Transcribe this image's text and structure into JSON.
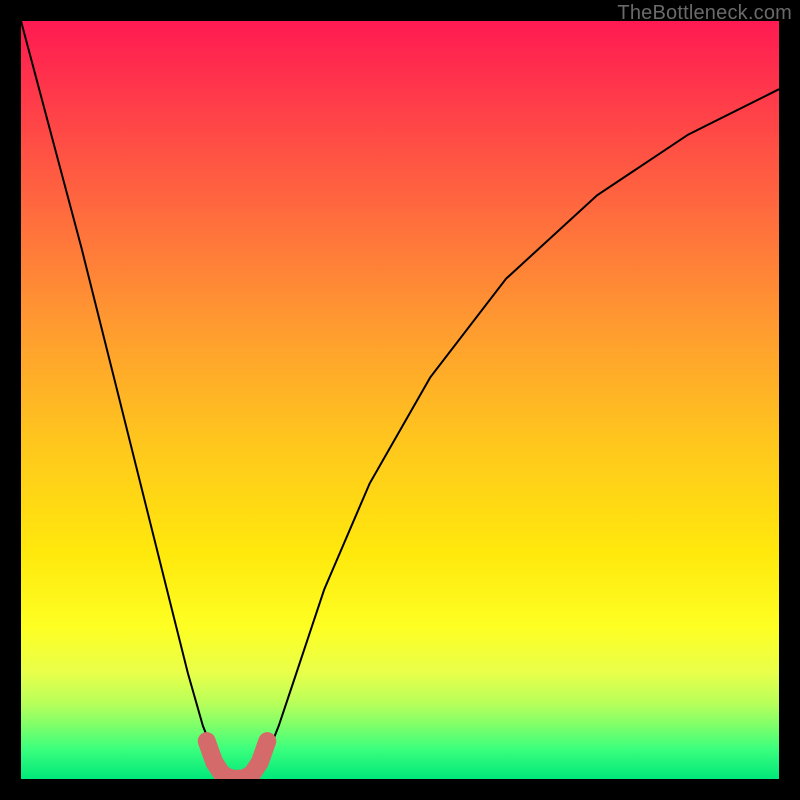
{
  "watermark": "TheBottleneck.com",
  "chart_data": {
    "type": "line",
    "title": "",
    "xlabel": "",
    "ylabel": "",
    "xlim": [
      0,
      100
    ],
    "ylim": [
      0,
      100
    ],
    "series": [
      {
        "name": "bottleneck-curve",
        "x": [
          0,
          4,
          8,
          12,
          16,
          20,
          22,
          24,
          26,
          27,
          28,
          29,
          30,
          31,
          32,
          34,
          36,
          40,
          46,
          54,
          64,
          76,
          88,
          100
        ],
        "y": [
          100,
          85,
          70,
          54,
          38,
          22,
          14,
          7,
          2,
          0.4,
          0,
          0,
          0,
          0.4,
          2,
          7,
          13,
          25,
          39,
          53,
          66,
          77,
          85,
          91
        ]
      }
    ],
    "highlight": {
      "name": "valley-highlight",
      "color": "#d46a6a",
      "x": [
        24.5,
        25.5,
        26.5,
        27.5,
        28.5,
        29.5,
        30.5,
        31.5,
        32.5
      ],
      "y": [
        5,
        2.2,
        0.7,
        0.1,
        0,
        0.1,
        0.7,
        2.2,
        5
      ]
    }
  }
}
